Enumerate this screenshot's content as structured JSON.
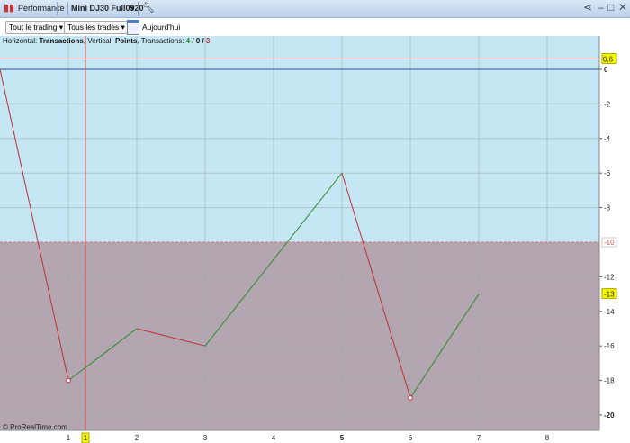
{
  "titlebar": {
    "tab_label": "Performance",
    "instrument": "Mini DJ30 Full0920"
  },
  "toolbar": {
    "filter1": "Tout le trading",
    "filter2": "Tous les trades",
    "date_label": "Aujourd'hui"
  },
  "info": {
    "h_label": "Horizontal: ",
    "h_value": "Transactions",
    "v_label": ", Vertical: ",
    "v_value": "Points",
    "t_label": ", Transactions: ",
    "wins": "4",
    "sep1": " / ",
    "even": "0",
    "sep2": " / ",
    "losses": "3"
  },
  "copyright": "© ProRealTime.com",
  "chart_data": {
    "type": "line",
    "x": [
      0,
      1,
      2,
      3,
      5,
      6,
      7
    ],
    "y": [
      0,
      -18,
      -15,
      -16,
      -6,
      -19,
      -13
    ],
    "xlabel": "Transactions",
    "ylabel": "Points",
    "xlim": [
      0,
      8.7
    ],
    "ylim": [
      -20.9,
      2
    ],
    "x_ticks": [
      "1",
      "2",
      "3",
      "4",
      "5",
      "6",
      "7",
      "8"
    ],
    "y_ticks": [
      "0",
      "-2",
      "-4",
      "-6",
      "-8",
      "-12",
      "-14",
      "-16",
      "-18",
      "-20"
    ],
    "markers": {
      "h_line_label": "0,6",
      "h_line_value": 0.6,
      "threshold_label": "-10",
      "threshold_value": -10,
      "last_value_label": "-13",
      "cursor_x_label": "1",
      "cursor_x_value": 1.25
    },
    "colors": {
      "up": "#2e8b2e",
      "down": "#c0303a",
      "upper_zone": "#c5e6f3",
      "lower_zone": "#b3a6b1"
    }
  }
}
